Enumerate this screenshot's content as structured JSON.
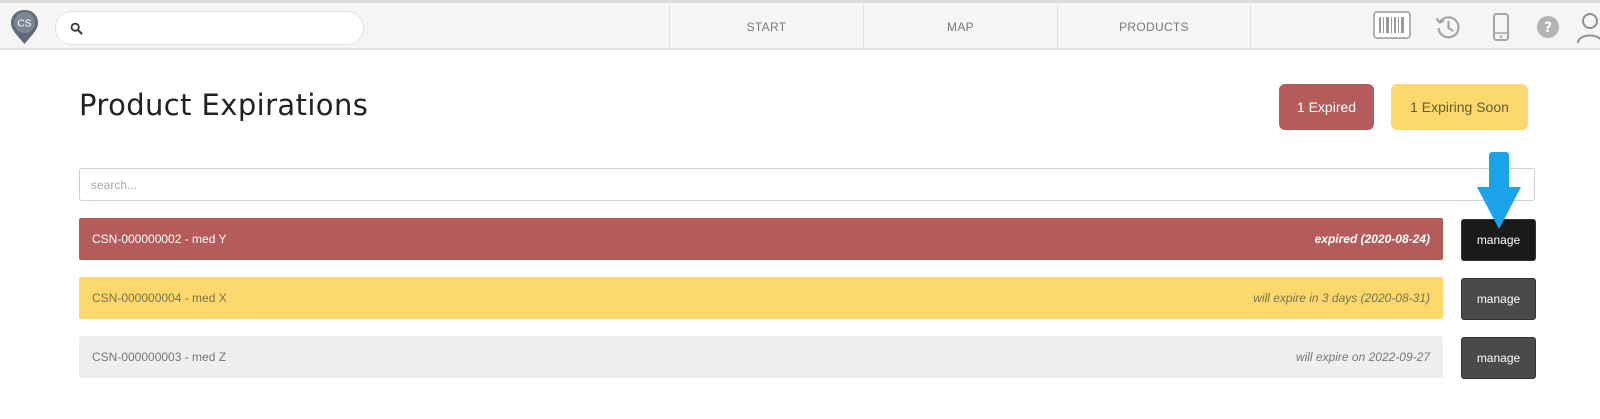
{
  "header": {
    "logo_text": "CS",
    "search": {
      "placeholder": "",
      "value": "",
      "icon": "search-icon"
    },
    "nav": [
      {
        "label": "START"
      },
      {
        "label": "MAP"
      },
      {
        "label": "PRODUCTS"
      }
    ],
    "toolbar_icons": [
      "barcode-icon",
      "history-icon",
      "mobile-icon",
      "help-icon",
      "user-icon"
    ]
  },
  "page": {
    "title": "Product Expirations",
    "badges": {
      "expired": "1 Expired",
      "expiring_soon": "1 Expiring Soon"
    },
    "filter": {
      "placeholder": "search...",
      "value": ""
    },
    "items": [
      {
        "name": "CSN-000000002 - med Y",
        "status": "expired (2020-08-24)",
        "state": "expired",
        "action": "manage"
      },
      {
        "name": "CSN-000000004 - med X",
        "status": "will expire in 3 days (2020-08-31)",
        "state": "expiring-soon",
        "action": "manage"
      },
      {
        "name": "CSN-000000003 - med Z",
        "status": "will expire on 2022-09-27",
        "state": "ok",
        "action": "manage"
      }
    ]
  },
  "colors": {
    "expired": "#b35c5a",
    "expiring_soon": "#fdd86c",
    "ok": "#efefef",
    "manage_button": "#4a4a4a",
    "annotation_arrow": "#1aa3e8"
  }
}
